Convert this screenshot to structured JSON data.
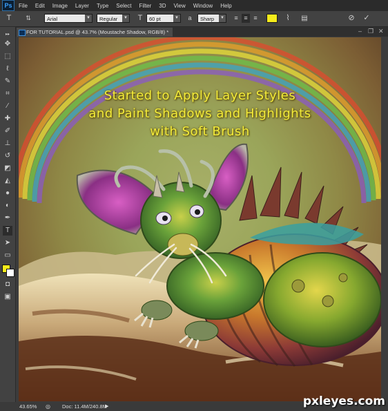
{
  "app": {
    "logo_text": "Ps"
  },
  "menu": [
    "File",
    "Edit",
    "Image",
    "Layer",
    "Type",
    "Select",
    "Filter",
    "3D",
    "View",
    "Window",
    "Help"
  ],
  "options": {
    "font_family": "Arial",
    "font_style": "Regular",
    "font_size": "60 pt",
    "anti_alias": "Sharp",
    "text_color": "#f5ec1b"
  },
  "document": {
    "tab_title": "FOR TUTORIAL.psd @ 43.7% (Moustache Shadow, RGB/8) *"
  },
  "canvas_text": {
    "line1": "Started to Apply Layer Styles",
    "line2": "and Paint Shadows and Highlights",
    "line3": "with Soft Brush"
  },
  "status": {
    "zoom": "43.65%",
    "doc_size": "Doc: 11.4M/240.8M"
  },
  "watermark": "pxleyes.com",
  "colors": {
    "foreground": "#f5ec1b",
    "background": "#ffffff",
    "text_overlay": "#f3ec3a"
  }
}
